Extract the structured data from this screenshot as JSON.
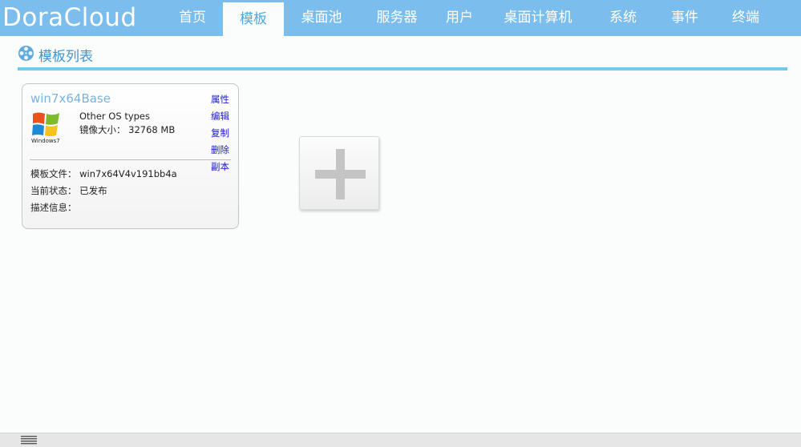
{
  "app": {
    "logo": "DoraCloud"
  },
  "nav": {
    "items": [
      {
        "label": "首页",
        "active": false
      },
      {
        "label": "模板",
        "active": true
      },
      {
        "label": "桌面池",
        "active": false
      },
      {
        "label": "服务器",
        "active": false
      },
      {
        "label": "用户",
        "active": false
      },
      {
        "label": "桌面计算机",
        "active": false
      },
      {
        "label": "系统",
        "active": false
      },
      {
        "label": "事件",
        "active": false
      },
      {
        "label": "终端",
        "active": false
      }
    ]
  },
  "section": {
    "title": "模板列表",
    "icon": "film-reel-icon"
  },
  "template_card": {
    "name": "win7x64Base",
    "os_logo_icon": "windows7-logo-icon",
    "os_logo_caption": "Windows7",
    "os_type": "Other OS types",
    "image_size_label": "镜像大小：",
    "image_size_value": "32768 MB",
    "template_file_label": "模板文件：",
    "template_file_value": "win7x64V4v191bb4a",
    "status_label": "当前状态：",
    "status_value": "已发布",
    "description_label": "描述信息：",
    "description_value": "",
    "actions": {
      "properties": "属性",
      "edit": "编辑",
      "copy": "复制",
      "delete": "删除",
      "replica": "副本"
    }
  },
  "add_template": {
    "icon": "plus-icon"
  },
  "colors": {
    "nav_bg": "#7bbdec",
    "accent": "#3d94d3",
    "card_title": "#7ab2e2",
    "link": "#1a1acc"
  }
}
